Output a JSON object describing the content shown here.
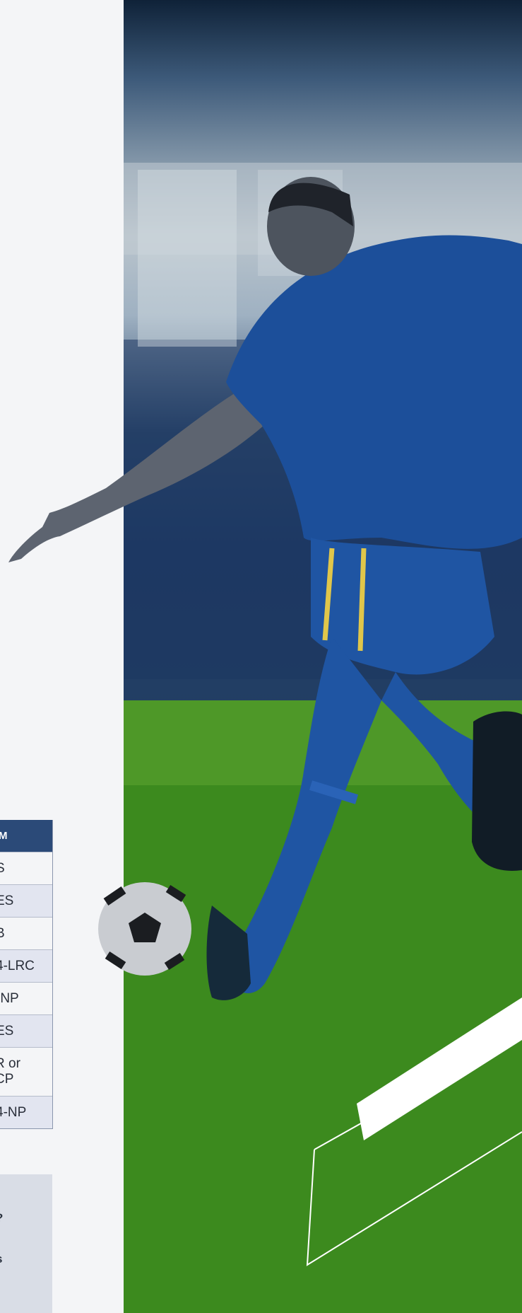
{
  "table": {
    "header": "M",
    "rows": [
      {
        "text": "S",
        "shade": false
      },
      {
        "text": "ES",
        "shade": true
      },
      {
        "text": "B",
        "shade": false
      },
      {
        "text": "4-LRC",
        "shade": true
      },
      {
        "text": "-NP",
        "shade": false
      },
      {
        "text": "ES",
        "shade": true
      },
      {
        "text": "R or CP",
        "shade": false
      },
      {
        "text": "4-NP",
        "shade": true
      }
    ]
  },
  "info_box": {
    "fragments": [
      "?",
      "s"
    ]
  },
  "photo": {
    "subject": "soccer-player-kicking-ball",
    "colors": {
      "jersey": "#1c4f9a",
      "grass": "#3f8a22",
      "stadium": "#2d4a6e"
    }
  }
}
